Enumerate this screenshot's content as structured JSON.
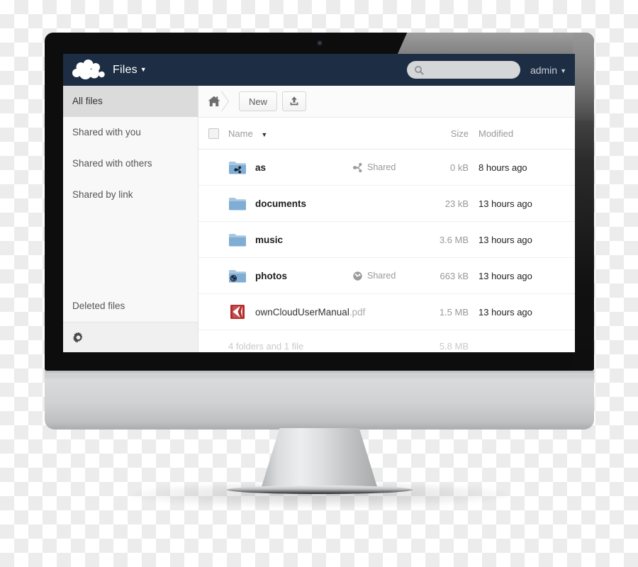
{
  "app": {
    "logo_icon": "owncloud-cloud-logo",
    "name": "Files",
    "caret": "▼"
  },
  "header": {
    "search": {
      "icon": "search-icon",
      "value": "",
      "placeholder": ""
    },
    "user": "admin",
    "user_caret": "▼"
  },
  "sidebar": {
    "items": [
      {
        "label": "All files",
        "active": true
      },
      {
        "label": "Shared with you",
        "active": false
      },
      {
        "label": "Shared with others",
        "active": false
      },
      {
        "label": "Shared by link",
        "active": false
      }
    ],
    "deleted_files": "Deleted files",
    "settings_icon": "gear-icon"
  },
  "toolbar": {
    "home_icon": "home-icon",
    "new_label": "New",
    "upload_icon": "upload-icon"
  },
  "table": {
    "headers": {
      "name": "Name",
      "sort_caret": "▼",
      "size": "Size",
      "modified": "Modified"
    },
    "rows": [
      {
        "icon": "folder-shared-icon",
        "name": "as",
        "ext": "",
        "is_folder": true,
        "share": {
          "icon": "share-network-icon",
          "label": "Shared"
        },
        "size": "0 kB",
        "modified": "8 hours ago"
      },
      {
        "icon": "folder-icon",
        "name": "documents",
        "ext": "",
        "is_folder": true,
        "share": null,
        "size": "23 kB",
        "modified": "13 hours ago"
      },
      {
        "icon": "folder-icon",
        "name": "music",
        "ext": "",
        "is_folder": true,
        "share": null,
        "size": "3.6 MB",
        "modified": "13 hours ago"
      },
      {
        "icon": "folder-public-icon",
        "name": "photos",
        "ext": "",
        "is_folder": true,
        "share": {
          "icon": "globe-icon",
          "label": "Shared"
        },
        "size": "663 kB",
        "modified": "13 hours ago"
      },
      {
        "icon": "pdf-file-icon",
        "name": "ownCloudUserManual",
        "ext": ".pdf",
        "is_folder": false,
        "share": null,
        "size": "1.5 MB",
        "modified": "13 hours ago"
      }
    ],
    "summary": {
      "count": "4 folders and 1 file",
      "total_size": "5.8 MB"
    }
  },
  "colors": {
    "header_bar": "#1d2d44",
    "sidebar_active": "#dbdbdb",
    "folder_blue": "#8eb7d9",
    "pdf_red": "#b52c2c",
    "bezel": "#0d0d0d"
  }
}
